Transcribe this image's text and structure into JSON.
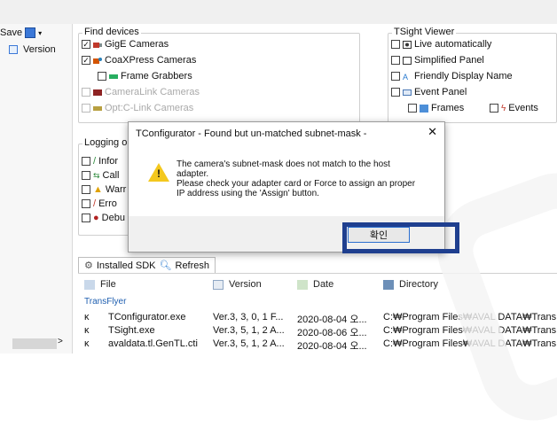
{
  "toolbar": {
    "save_label": "Save"
  },
  "left_panel": {
    "version_label": "Version",
    "scroll_arrow": ">"
  },
  "find_devices": {
    "title": "Find devices",
    "gige": "GigE Cameras",
    "coaxpress": "CoaXPress Cameras",
    "frame_grabbers": "Frame Grabbers",
    "cameralink": "CameraLink Cameras",
    "optc": "Opt:C-Link Cameras"
  },
  "tsight": {
    "title": "TSight Viewer",
    "live": "Live automatically",
    "simplified": "Simplified Panel",
    "friendly": "Friendly Display Name",
    "event_panel": "Event Panel",
    "frames": "Frames",
    "events": "Events"
  },
  "logging": {
    "title": "Logging o",
    "items": [
      "Infor",
      "Call",
      "Warr",
      "Erro",
      "Debu"
    ]
  },
  "dialog": {
    "title": "TConfigurator - Found but un-matched subnet-mask -",
    "close": "✕",
    "message_lines": [
      "The camera's subnet-mask does not match to the host",
      "adapter.",
      "Please check your adapter card or Force to assign an proper",
      "IP address using the 'Assign' button."
    ],
    "ok_label": "확인"
  },
  "sdk": {
    "tab_label": "Installed SDK",
    "refresh_label": "Refresh",
    "columns": [
      "File",
      "Version",
      "Date",
      "Directory"
    ],
    "group_name": "TransFlyer",
    "rows": [
      {
        "arrow": "κ",
        "file": "TConfigurator.exe",
        "version": "Ver.3, 3, 0, 1 F...",
        "date": "2020-08-04 오...",
        "directory": "C:₩Program Files₩AVAL DATA₩Trans"
      },
      {
        "arrow": "κ",
        "file": "TSight.exe",
        "version": "Ver.3, 5, 1, 2 A...",
        "date": "2020-08-06 오...",
        "directory": "C:₩Program Files₩AVAL DATA₩Trans"
      },
      {
        "arrow": "κ",
        "file": "avaldata.tl.GenTL.cti",
        "version": "Ver.3, 5, 1, 2 A...",
        "date": "2020-08-04 오...",
        "directory": "C:₩Program Files₩AVAL DATA₩Trans"
      }
    ]
  },
  "colors": {
    "highlight": "#1f3f8f",
    "warning": "#f4c81e",
    "link": "#1f5fb0"
  }
}
